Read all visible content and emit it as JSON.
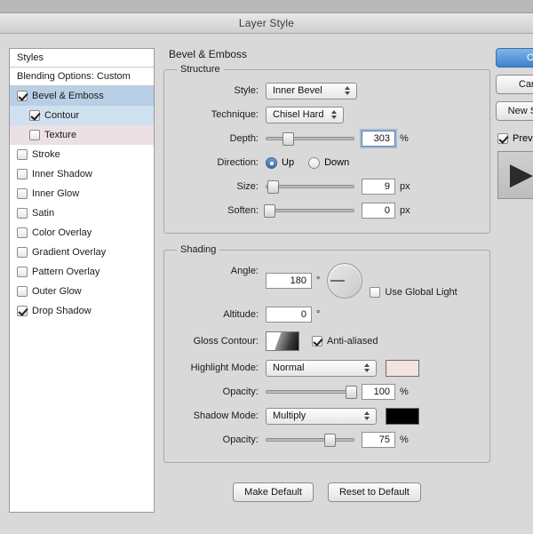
{
  "window": {
    "title": "Layer Style"
  },
  "styles_panel": {
    "header": "Styles",
    "blending_options": "Blending Options: Custom",
    "items": [
      {
        "label": "Bevel & Emboss",
        "checked": true,
        "selected": true,
        "sub": false
      },
      {
        "label": "Contour",
        "checked": true,
        "selected": false,
        "sub": true,
        "sub_selected": true
      },
      {
        "label": "Texture",
        "checked": false,
        "selected": false,
        "sub": true,
        "sub_light": true
      },
      {
        "label": "Stroke",
        "checked": false,
        "selected": false,
        "sub": false
      },
      {
        "label": "Inner Shadow",
        "checked": false,
        "selected": false,
        "sub": false
      },
      {
        "label": "Inner Glow",
        "checked": false,
        "selected": false,
        "sub": false
      },
      {
        "label": "Satin",
        "checked": false,
        "selected": false,
        "sub": false
      },
      {
        "label": "Color Overlay",
        "checked": false,
        "selected": false,
        "sub": false
      },
      {
        "label": "Gradient Overlay",
        "checked": false,
        "selected": false,
        "sub": false
      },
      {
        "label": "Pattern Overlay",
        "checked": false,
        "selected": false,
        "sub": false
      },
      {
        "label": "Outer Glow",
        "checked": false,
        "selected": false,
        "sub": false
      },
      {
        "label": "Drop Shadow",
        "checked": true,
        "selected": false,
        "sub": false
      }
    ]
  },
  "main": {
    "title": "Bevel & Emboss",
    "structure": {
      "legend": "Structure",
      "style_label": "Style:",
      "style_value": "Inner Bevel",
      "technique_label": "Technique:",
      "technique_value": "Chisel Hard",
      "depth_label": "Depth:",
      "depth_value": "303",
      "depth_unit": "%",
      "direction_label": "Direction:",
      "direction_up": "Up",
      "direction_down": "Down",
      "size_label": "Size:",
      "size_value": "9",
      "size_unit": "px",
      "soften_label": "Soften:",
      "soften_value": "0",
      "soften_unit": "px"
    },
    "shading": {
      "legend": "Shading",
      "angle_label": "Angle:",
      "angle_value": "180",
      "angle_unit": "°",
      "use_global_light": "Use Global Light",
      "altitude_label": "Altitude:",
      "altitude_value": "0",
      "altitude_unit": "°",
      "gloss_contour_label": "Gloss Contour:",
      "anti_aliased": "Anti-aliased",
      "highlight_mode_label": "Highlight Mode:",
      "highlight_mode_value": "Normal",
      "highlight_color": "#f3e2e2",
      "highlight_opacity_label": "Opacity:",
      "highlight_opacity_value": "100",
      "highlight_opacity_unit": "%",
      "shadow_mode_label": "Shadow Mode:",
      "shadow_mode_value": "Multiply",
      "shadow_color": "#000000",
      "shadow_opacity_label": "Opacity:",
      "shadow_opacity_value": "75",
      "shadow_opacity_unit": "%"
    },
    "buttons": {
      "make_default": "Make Default",
      "reset_to_default": "Reset to Default"
    }
  },
  "right": {
    "ok": "OK",
    "cancel": "Cancel",
    "new_style": "New Style...",
    "preview": "Preview",
    "preview_glyph": "▶"
  }
}
